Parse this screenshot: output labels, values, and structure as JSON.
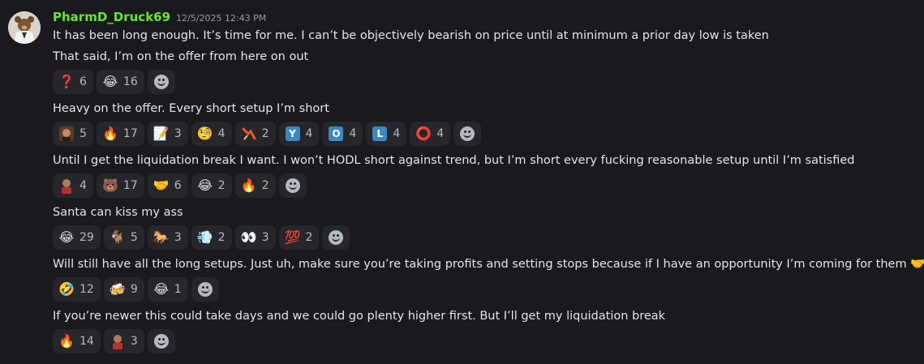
{
  "user": {
    "username": "PharmD_Druck69",
    "timestamp": "12/5/2025 12:43 PM",
    "username_color": "#67e632"
  },
  "messages": [
    {
      "lines": [
        "It has been long enough. It’s time for me. I can’t be objectively bearish on price until at minimum a prior day low is taken",
        "That said, I’m on the offer from here on out"
      ],
      "reactions": [
        {
          "emoji": "❓",
          "icon": "question-mark-icon",
          "count": "6"
        },
        {
          "emoji": "😂",
          "icon": "tears-of-joy-icon",
          "count": "16"
        }
      ]
    },
    {
      "lines": [
        "Heavy on the offer. Every short setup I’m short"
      ],
      "reactions": [
        {
          "emoji": "",
          "icon": "custom-face-icon",
          "count": "5"
        },
        {
          "emoji": "🔥",
          "icon": "fire-icon",
          "count": "17"
        },
        {
          "emoji": "📝",
          "icon": "memo-icon",
          "count": "3"
        },
        {
          "emoji": "🧐",
          "icon": "monocle-face-icon",
          "count": "4"
        },
        {
          "emoji": "",
          "icon": "custom-chart-down-icon",
          "count": "2"
        },
        {
          "emoji": "Y",
          "icon": "letter-y-icon",
          "count": "4"
        },
        {
          "emoji": "O",
          "icon": "letter-o-icon",
          "count": "4"
        },
        {
          "emoji": "L",
          "icon": "letter-l-icon",
          "count": "4"
        },
        {
          "emoji": "⭕",
          "icon": "hollow-circle-icon",
          "count": "4"
        }
      ]
    },
    {
      "lines": [
        "Until I get the liquidation break I want. I won’t HODL short against trend, but I’m short every fucking reasonable setup until I’m satisfied"
      ],
      "reactions": [
        {
          "emoji": "",
          "icon": "custom-person-icon",
          "count": "4"
        },
        {
          "emoji": "🐻",
          "icon": "bear-icon",
          "count": "17"
        },
        {
          "emoji": "🤝",
          "icon": "handshake-icon",
          "count": "6"
        },
        {
          "emoji": "😂",
          "icon": "tears-of-joy-icon",
          "count": "2"
        },
        {
          "emoji": "🔥",
          "icon": "fire-icon",
          "count": "2"
        }
      ]
    },
    {
      "lines": [
        "Santa can kiss my ass"
      ],
      "reactions": [
        {
          "emoji": "😂",
          "icon": "tears-of-joy-icon",
          "count": "29"
        },
        {
          "emoji": "🐐",
          "icon": "goat-icon",
          "count": "5"
        },
        {
          "emoji": "🐎",
          "icon": "horse-icon",
          "count": "3"
        },
        {
          "emoji": "💨",
          "icon": "dust-cloud-icon",
          "count": "2"
        },
        {
          "emoji": "👀",
          "icon": "eyes-icon",
          "count": "3"
        },
        {
          "emoji": "💯",
          "icon": "hundred-points-icon",
          "count": "2"
        }
      ]
    },
    {
      "lines": [
        "Will still have all the long setups. Just uh, make sure you’re taking profits and setting stops because if I have an opportunity I’m coming for them 🤝"
      ],
      "reactions": [
        {
          "emoji": "🤣",
          "icon": "rofl-icon",
          "count": "12"
        },
        {
          "emoji": "🍻",
          "icon": "clinking-beers-icon",
          "count": "9"
        },
        {
          "emoji": "😂",
          "icon": "tears-of-joy-icon",
          "count": "1"
        }
      ]
    },
    {
      "lines": [
        "If you’re newer this could take days and we could go plenty higher first. But I’ll get my liquidation break"
      ],
      "reactions": [
        {
          "emoji": "🔥",
          "icon": "fire-icon",
          "count": "14"
        },
        {
          "emoji": "",
          "icon": "custom-person-icon",
          "count": "3"
        }
      ]
    }
  ]
}
